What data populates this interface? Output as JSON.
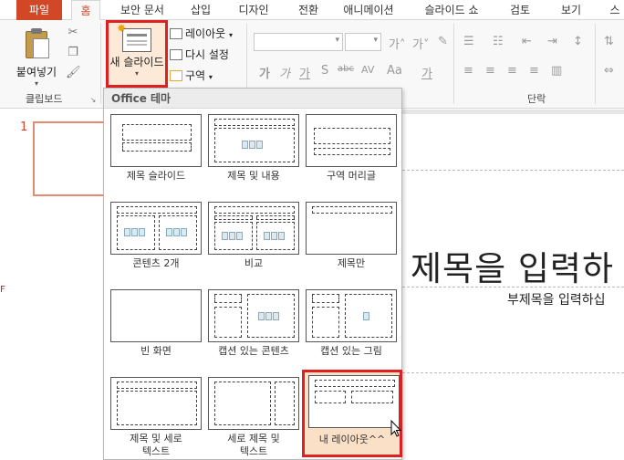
{
  "ribbon_tabs": [
    "파일",
    "홈",
    "보안 문서",
    "삽입",
    "디자인",
    "전환",
    "애니메이션",
    "슬라이드 쇼",
    "검토",
    "보기",
    "스"
  ],
  "clipboard": {
    "paste_label": "붙여넣기",
    "group_label": "클립보드"
  },
  "slides_group": {
    "new_slide_label": "새 슬라이드",
    "layout_label": "레이아웃",
    "reset_label": "다시 설정",
    "section_label": "구역"
  },
  "paragraph_group_label": "단락",
  "font_buttons": [
    "가",
    "가",
    "가",
    "S",
    "abc",
    "AV",
    "Aa",
    "가"
  ],
  "gallery": {
    "header": "Office 테마",
    "layouts": [
      {
        "label": "제목 슬라이드"
      },
      {
        "label": "제목 및 내용"
      },
      {
        "label": "구역 머리글"
      },
      {
        "label": "콘텐츠 2개"
      },
      {
        "label": "비교"
      },
      {
        "label": "제목만"
      },
      {
        "label": "빈 화면"
      },
      {
        "label": "캡션 있는 콘텐츠"
      },
      {
        "label": "캡션 있는 그림"
      },
      {
        "label": "제목 및 세로\n텍스트"
      },
      {
        "label": "세로 제목 및\n텍스트"
      },
      {
        "label": "내 레이아웃^^"
      }
    ]
  },
  "thumbnail": {
    "number": "1"
  },
  "slide": {
    "title_placeholder": "제목을 입력하",
    "subtitle_placeholder": "부제목을 입력하십"
  },
  "accent_colors": {
    "file_tab": "#d24726",
    "highlight": "#e02020",
    "hover_fill": "#fce9d7"
  }
}
